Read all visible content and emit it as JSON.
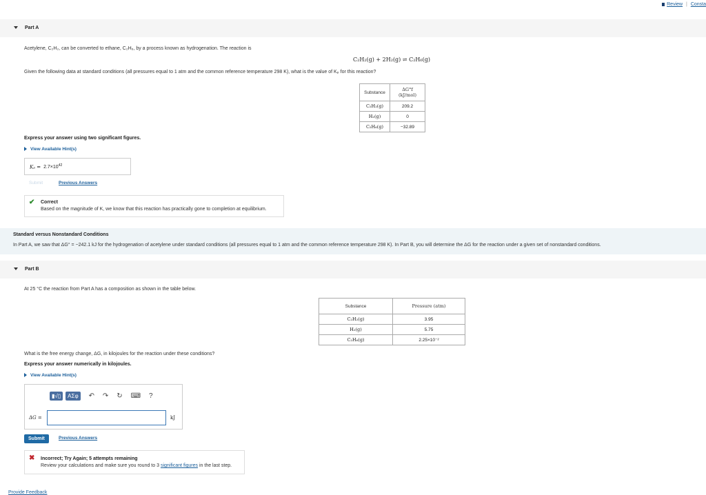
{
  "top": {
    "review": "Review",
    "sep": "|",
    "constants": "Consta"
  },
  "partA": {
    "title": "Part A",
    "intro": "Acetylene, C₂H₂, can be converted to ethane, C₂H₆, by a process known as hydrogenation. The reaction is",
    "reaction": "C₂H₂(g) + 2H₂(g) ⇌ C₂H₆(g)",
    "question": "Given the following data at standard conditions (all pressures equal to 1 atm and the common reference temperature 298 K), what is the value of Kₚ for this reaction?",
    "table": {
      "headers": [
        "Substance",
        "ΔG°f (kJ/mol)"
      ],
      "rows": [
        [
          "C₂H₂(g)",
          "209.2"
        ],
        [
          "H₂(g)",
          "0"
        ],
        [
          "C₂H₆(g)",
          "−32.89"
        ]
      ]
    },
    "instruction": "Express your answer using two significant figures.",
    "hint_link": "View Available Hint(s)",
    "answer_label": "Kₚ =",
    "answer_value": "2.7×10",
    "answer_exp": "42",
    "submit": "Submit",
    "previous": "Previous Answers",
    "feedback_title": "Correct",
    "feedback_text": "Based on the magnitude of K, we know that this reaction has practically gone to completion at equilibrium."
  },
  "info": {
    "title": "Standard versus Nonstandard Conditions",
    "text": "In Part A, we saw that ΔG° = −242.1 kJ for the hydrogenation of acetylene under standard conditions (all pressures equal to 1 atm and the common reference temperature 298 K). In Part B, you will determine the ΔG for the reaction under a given set of nonstandard conditions."
  },
  "partB": {
    "title": "Part B",
    "intro": "At 25 °C the reaction from Part A has a composition as shown in the table below.",
    "table": {
      "headers": [
        "Substance",
        "Pressure (atm)"
      ],
      "rows": [
        [
          "C₂H₂(g)",
          "3.95"
        ],
        [
          "H₂(g)",
          "5.75"
        ],
        [
          "C₂H₆(g)",
          "2.25×10⁻²"
        ]
      ]
    },
    "question": "What is the free energy change, ΔG, in kilojoules for the reaction under these conditions?",
    "instruction": "Express your answer numerically in kilojoules.",
    "hint_link": "View Available Hint(s)",
    "answer_label": "ΔG =",
    "answer_value": "",
    "unit": "kJ",
    "toolbar": {
      "templates": "▮√▯",
      "symbols": "ΑΣφ",
      "undo": "↶",
      "redo": "↷",
      "reset": "↻",
      "keyboard": "⌨",
      "help": "?"
    },
    "submit": "Submit",
    "previous": "Previous Answers",
    "feedback_title": "Incorrect; Try Again; 5 attempts remaining",
    "feedback_text_pre": "Review your calculations and make sure you round to 3",
    "feedback_link": "significant figures",
    "feedback_text_post": "in the last step."
  },
  "footer": {
    "feedback": "Provide Feedback"
  }
}
